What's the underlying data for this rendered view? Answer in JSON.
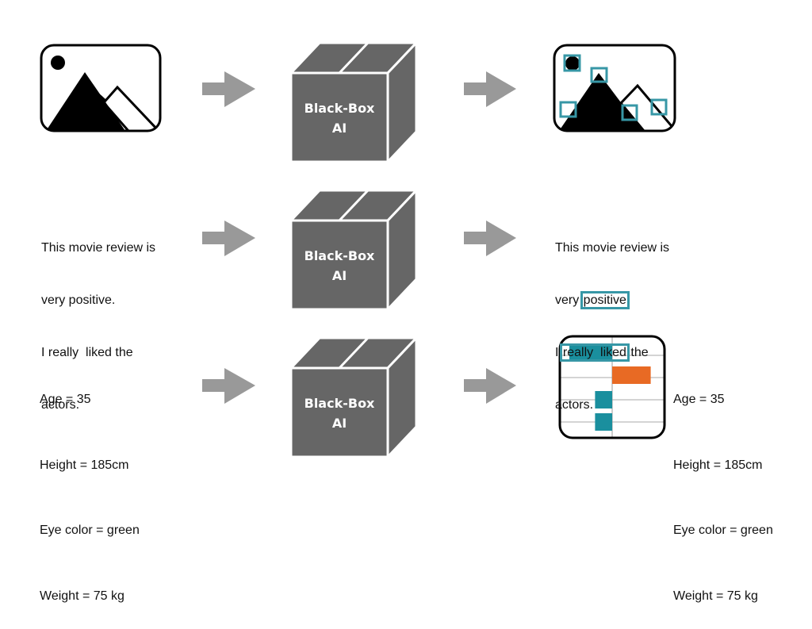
{
  "colors": {
    "box_fill": "#666666",
    "arrow_fill": "#999999",
    "highlight": "#3797a6",
    "bar_teal": "#1a8f9e",
    "bar_orange": "#e86a24",
    "outline": "#000000"
  },
  "black_box": {
    "line1": "Black-Box",
    "line2": "AI"
  },
  "rows": [
    {
      "input_type": "image",
      "input_icon": "image-landscape-icon",
      "output_icon": "image-with-highlighted-regions-icon"
    },
    {
      "input_type": "text",
      "input_lines": [
        "This movie review is",
        "very positive.",
        "I really  liked the",
        "actors."
      ],
      "output": {
        "line1": "This movie review is",
        "line2_pre": "very ",
        "line2_hl": "positive",
        "line2_post": ".",
        "line3_pre": "I ",
        "line3_hl": "really  liked",
        "line3_post": " the",
        "line4": "actors."
      }
    },
    {
      "input_type": "tabular",
      "features": [
        "Age = 35",
        "Height = 185cm",
        "Eye color = green",
        "Weight = 75 kg"
      ],
      "attributions": [
        {
          "feature": "Age",
          "value": -1.0,
          "color": "teal"
        },
        {
          "feature": "Height",
          "value": 0.9,
          "color": "orange"
        },
        {
          "feature": "Eye color",
          "value": -0.4,
          "color": "teal"
        },
        {
          "feature": "Weight",
          "value": -0.4,
          "color": "teal"
        }
      ]
    }
  ]
}
